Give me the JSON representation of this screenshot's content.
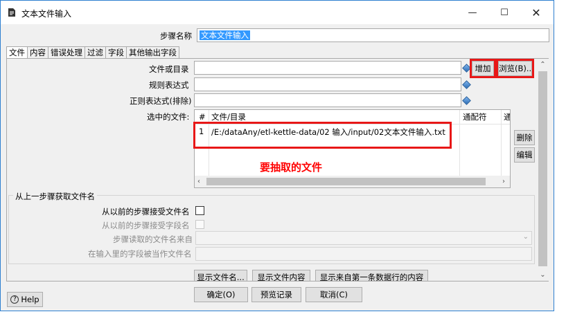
{
  "window": {
    "title": "文本文件输入",
    "minimize": "—",
    "maximize": "☐",
    "close": "✕"
  },
  "step_name": {
    "label": "步骤名称",
    "value": "文本文件输入"
  },
  "tabs": [
    "文件",
    "内容",
    "错误处理",
    "过滤",
    "字段",
    "其他输出字段"
  ],
  "file_panel": {
    "file_or_dir_label": "文件或目录",
    "regex_label": "规则表达式",
    "regex_exclude_label": "正则表达式(排除)",
    "selected_files_label": "选中的文件:",
    "add_button": "增加",
    "browse_button": "浏览(B)...",
    "delete_button": "删除",
    "edit_button": "编辑",
    "table": {
      "columns": [
        "#",
        "文件/目录",
        "通配符",
        "通"
      ],
      "rows": [
        {
          "num": "1",
          "path": "/E:/dataAny/etl-kettle-data/02 输入/input/02文本文件输入.txt"
        }
      ]
    },
    "annotation": "要抽取的文件"
  },
  "prev_step_group": {
    "title": "从上一步骤获取文件名",
    "accept_filenames_label": "从以前的步骤接受文件名",
    "accept_fieldnames_label": "从以前的步骤接受字段名",
    "step_read_from_label": "步骤读取的文件名来自",
    "field_as_filename_label": "在输入里的字段被当作文件名"
  },
  "panel_buttons": {
    "show_filenames": "显示文件名...",
    "show_content": "显示文件内容",
    "show_first_row": "显示来自第一条数据行的内容"
  },
  "footer": {
    "help": "Help",
    "ok": "确定(O)",
    "preview": "预览记录",
    "cancel": "取消(C)"
  },
  "colors": {
    "highlight_red": "#e81717",
    "selection_blue": "#3399ff"
  }
}
